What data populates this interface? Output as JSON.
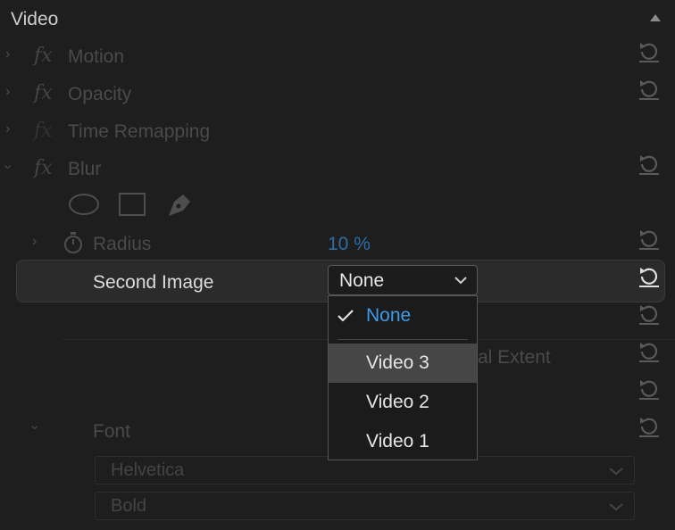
{
  "panel": {
    "title": "Video",
    "effects": [
      {
        "fx": "fx",
        "name": "Motion"
      },
      {
        "fx": "fx",
        "name": "Opacity"
      },
      {
        "fx": "fx",
        "name": "Time Remapping"
      },
      {
        "fx": "fx",
        "name": "Blur"
      }
    ]
  },
  "blur": {
    "masks": [
      "ellipse-mask-icon",
      "rectangle-mask-icon",
      "pen-mask-icon"
    ],
    "radius_label": "Radius",
    "radius_value": "10 %",
    "second_image_label": "Second Image",
    "second_image_value": "None",
    "obscured_label": "al Extent",
    "font_label": "Font",
    "font_family": "Helvetica",
    "font_style": "Bold"
  },
  "menu": {
    "items": [
      {
        "label": "None",
        "checked": true
      },
      {
        "label": "Video 3"
      },
      {
        "label": "Video 2"
      },
      {
        "label": "Video 1"
      }
    ]
  },
  "colors": {
    "accent": "#3d9be9",
    "background": "#1e1e1e",
    "link_value": "#2e6da3"
  }
}
